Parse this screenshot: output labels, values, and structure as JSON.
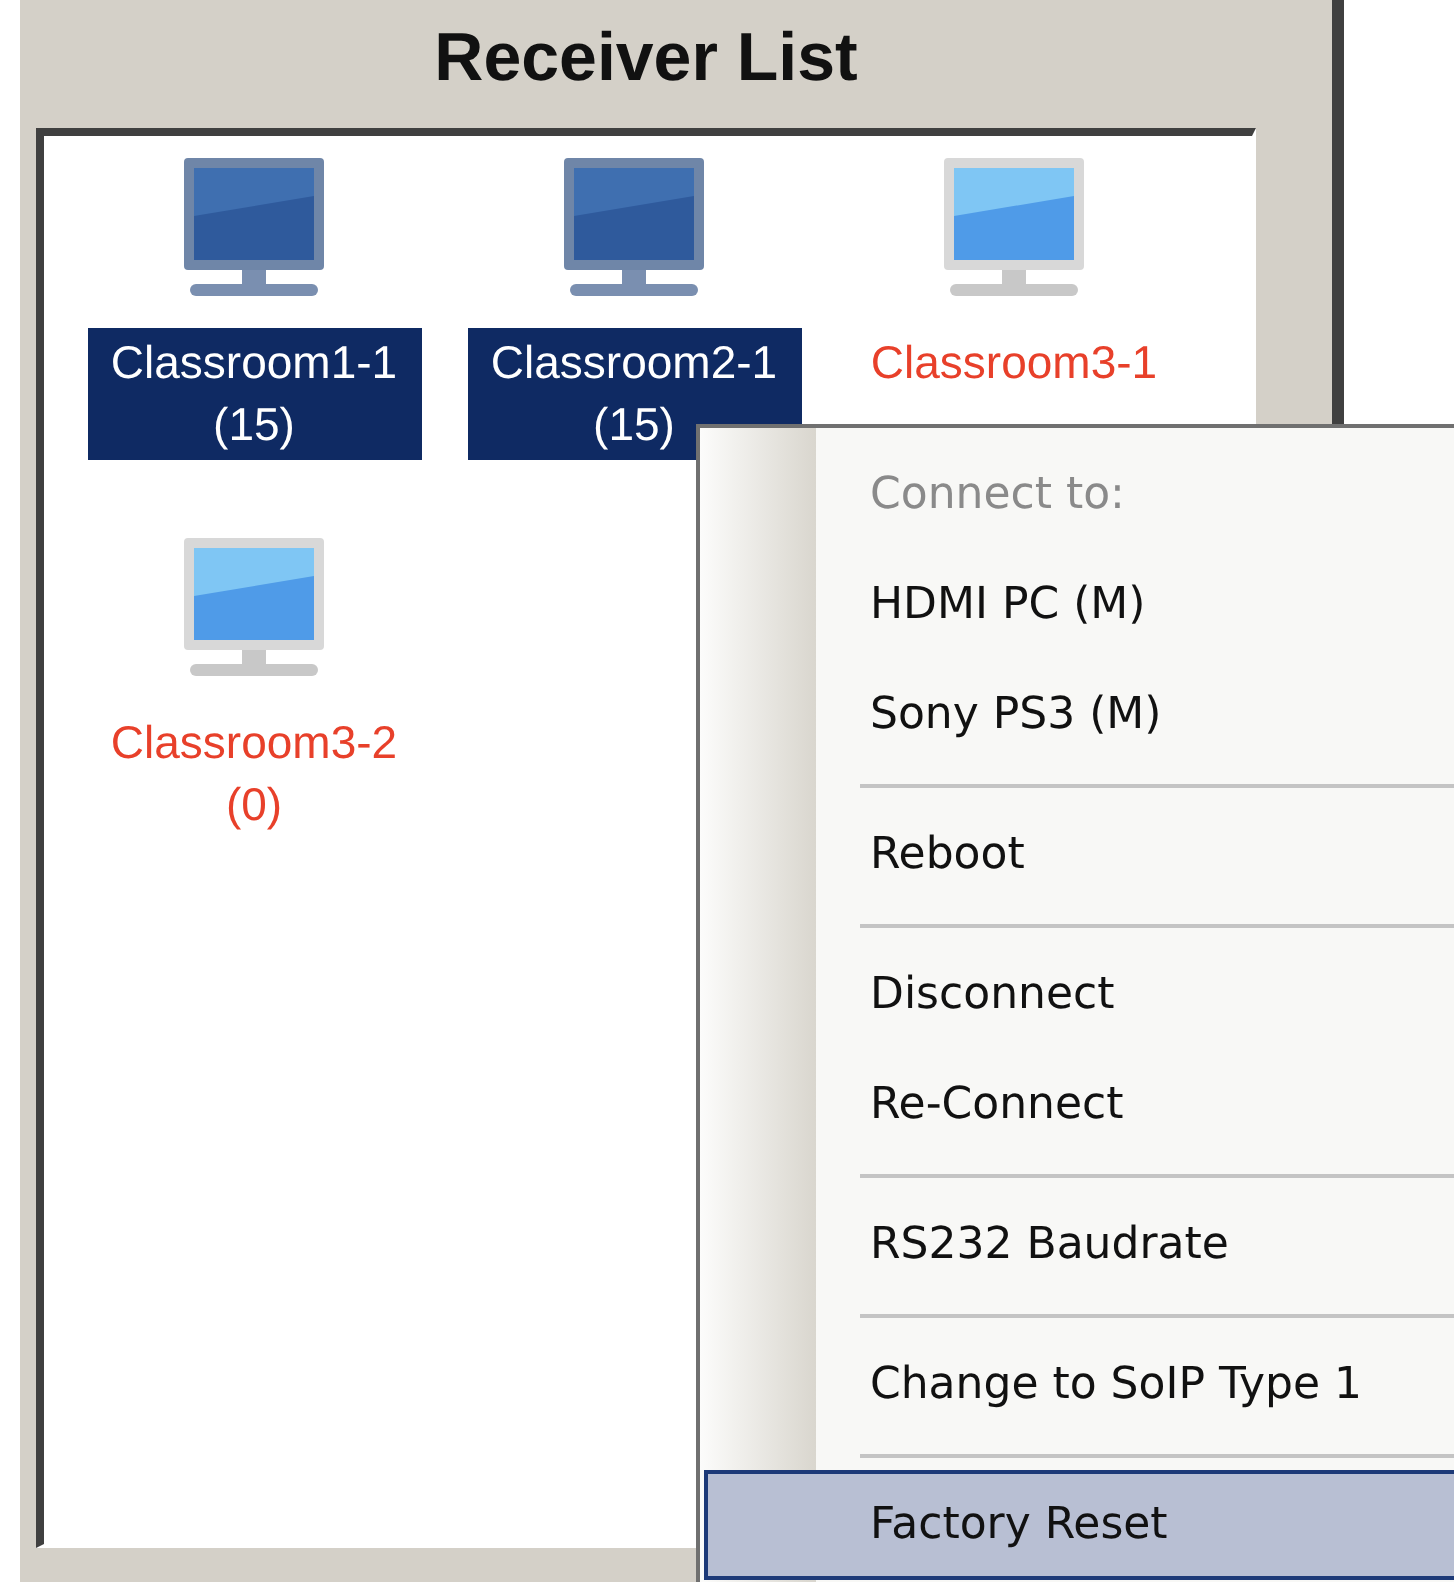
{
  "panel": {
    "title": "Receiver List"
  },
  "receivers": [
    {
      "name": "Classroom1-1",
      "count": "(15)",
      "online": true,
      "selected": true
    },
    {
      "name": "Classroom2-1",
      "count": "(15)",
      "online": true,
      "selected": true
    },
    {
      "name": "Classroom3-1",
      "online": false,
      "selected": false
    },
    {
      "name": "Classroom3-2",
      "count": "(0)",
      "online": false,
      "selected": false
    }
  ],
  "context_menu": {
    "items": [
      {
        "kind": "item",
        "label": "Connect to:",
        "disabled": true,
        "selected": false
      },
      {
        "kind": "item",
        "label": "HDMI PC (M)",
        "disabled": false,
        "selected": false
      },
      {
        "kind": "item",
        "label": "Sony PS3 (M)",
        "disabled": false,
        "selected": false
      },
      {
        "kind": "separator"
      },
      {
        "kind": "item",
        "label": "Reboot",
        "disabled": false,
        "selected": false
      },
      {
        "kind": "separator"
      },
      {
        "kind": "item",
        "label": "Disconnect",
        "disabled": false,
        "selected": false
      },
      {
        "kind": "item",
        "label": "Re-Connect",
        "disabled": false,
        "selected": false
      },
      {
        "kind": "separator"
      },
      {
        "kind": "item",
        "label": "RS232 Baudrate",
        "disabled": false,
        "selected": false
      },
      {
        "kind": "separator"
      },
      {
        "kind": "item",
        "label": "Change to SoIP Type 1",
        "disabled": false,
        "selected": false
      },
      {
        "kind": "separator"
      },
      {
        "kind": "item",
        "label": "Factory Reset",
        "disabled": false,
        "selected": true
      }
    ]
  }
}
